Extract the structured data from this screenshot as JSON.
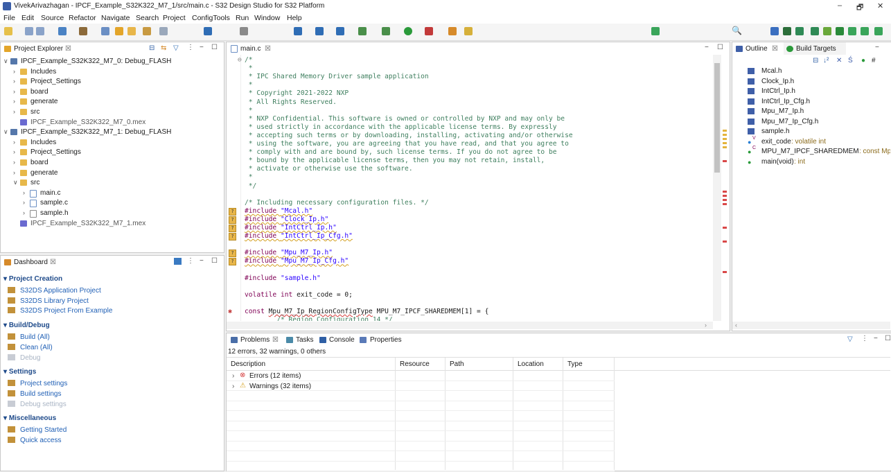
{
  "window": {
    "title": "VivekArivazhagan - IPCF_Example_S32K322_M7_1/src/main.c - S32 Design Studio for S32 Platform",
    "minimize": "–",
    "restore": "🗗",
    "close": "✕"
  },
  "menu": [
    "File",
    "Edit",
    "Source",
    "Refactor",
    "Navigate",
    "Search",
    "Project",
    "ConfigTools",
    "Run",
    "Window",
    "Help"
  ],
  "project_explorer": {
    "tab": "Project Explorer",
    "items": [
      {
        "label": "IPCF_Example_S32K322_M7_0: Debug_FLASH",
        "level": 0,
        "type": "proj",
        "expanded": true
      },
      {
        "label": "Includes",
        "level": 1,
        "type": "inc"
      },
      {
        "label": "Project_Settings",
        "level": 1,
        "type": "fold"
      },
      {
        "label": "board",
        "level": 1,
        "type": "fold"
      },
      {
        "label": "generate",
        "level": 1,
        "type": "fold"
      },
      {
        "label": "src",
        "level": 1,
        "type": "fold"
      },
      {
        "label": "IPCF_Example_S32K322_M7_0.mex",
        "level": 1,
        "type": "mex"
      },
      {
        "label": "IPCF_Example_S32K322_M7_1: Debug_FLASH",
        "level": 0,
        "type": "proj",
        "expanded": true
      },
      {
        "label": "Includes",
        "level": 1,
        "type": "inc"
      },
      {
        "label": "Project_Settings",
        "level": 1,
        "type": "fold"
      },
      {
        "label": "board",
        "level": 1,
        "type": "fold"
      },
      {
        "label": "generate",
        "level": 1,
        "type": "fold"
      },
      {
        "label": "src",
        "level": 1,
        "type": "fold",
        "expanded": true
      },
      {
        "label": "main.c",
        "level": 2,
        "type": "c"
      },
      {
        "label": "sample.c",
        "level": 2,
        "type": "c"
      },
      {
        "label": "sample.h",
        "level": 2,
        "type": "h"
      },
      {
        "label": "IPCF_Example_S32K322_M7_1.mex",
        "level": 1,
        "type": "mex"
      }
    ]
  },
  "dashboard": {
    "tab": "Dashboard",
    "sections": [
      {
        "title": "Project Creation",
        "items": [
          {
            "label": "S32DS Application Project",
            "enabled": true
          },
          {
            "label": "S32DS Library Project",
            "enabled": true
          },
          {
            "label": "S32DS Project From Example",
            "enabled": true
          }
        ]
      },
      {
        "title": "Build/Debug",
        "items": [
          {
            "label": "Build  (All)",
            "enabled": true
          },
          {
            "label": "Clean  (All)",
            "enabled": true
          },
          {
            "label": "Debug",
            "enabled": false
          }
        ]
      },
      {
        "title": "Settings",
        "items": [
          {
            "label": "Project settings",
            "enabled": true
          },
          {
            "label": "Build settings",
            "enabled": true
          },
          {
            "label": "Debug settings",
            "enabled": false
          }
        ]
      },
      {
        "title": "Miscellaneous",
        "items": [
          {
            "label": "Getting Started",
            "enabled": true
          },
          {
            "label": "Quick access",
            "enabled": true
          }
        ]
      }
    ]
  },
  "editor": {
    "tab": "main.c",
    "lines": [
      {
        "t": "/*",
        "c": "cm",
        "fold": "⊖"
      },
      {
        "t": " *",
        "c": "cm"
      },
      {
        "t": " * IPC Shared Memory Driver sample application",
        "c": "cm"
      },
      {
        "t": " *",
        "c": "cm"
      },
      {
        "t": " * Copyright 2021-2022 NXP",
        "c": "cm"
      },
      {
        "t": " * All Rights Reserved.",
        "c": "cm"
      },
      {
        "t": " *",
        "c": "cm"
      },
      {
        "t": " * NXP Confidential. This software is owned or controlled by NXP and may only be",
        "c": "cm"
      },
      {
        "t": " * used strictly in accordance with the applicable license terms. By expressly",
        "c": "cm"
      },
      {
        "t": " * accepting such terms or by downloading, installing, activating and/or otherwise",
        "c": "cm"
      },
      {
        "t": " * using the software, you are agreeing that you have read, and that you agree to",
        "c": "cm"
      },
      {
        "t": " * comply with and are bound by, such license terms. If you do not agree to be",
        "c": "cm"
      },
      {
        "t": " * bound by the applicable license terms, then you may not retain, install,",
        "c": "cm"
      },
      {
        "t": " * activate or otherwise use the software.",
        "c": "cm"
      },
      {
        "t": " *",
        "c": "cm"
      },
      {
        "t": " */",
        "c": "cm"
      },
      {
        "t": "",
        "c": ""
      },
      {
        "t": "/* Including necessary configuration files. */",
        "c": "cm"
      },
      {
        "t": "#include \"Mcal.h\"",
        "c": "inc",
        "warn": true
      },
      {
        "t": "#include \"Clock_Ip.h\"",
        "c": "inc",
        "warn": true
      },
      {
        "t": "#include \"IntCtrl_Ip.h\"",
        "c": "inc",
        "warn": true
      },
      {
        "t": "#include \"IntCtrl_Ip_Cfg.h\"",
        "c": "inc",
        "warn": true
      },
      {
        "t": "",
        "c": ""
      },
      {
        "t": "#include \"Mpu_M7_Ip.h\"",
        "c": "inc",
        "warn": true
      },
      {
        "t": "#include \"Mpu_M7_Ip_Cfg.h\"",
        "c": "inc",
        "warn": true
      },
      {
        "t": "",
        "c": ""
      },
      {
        "t": "#include \"sample.h\"",
        "c": "inc2"
      },
      {
        "t": "",
        "c": ""
      },
      {
        "t": "volatile int exit_code = 0;",
        "c": "decl"
      },
      {
        "t": "",
        "c": ""
      },
      {
        "t": "const Mpu_M7_Ip_RegionConfigType MPU_M7_IPCF_SHAREDMEM[1] = {",
        "c": "const",
        "err": true
      },
      {
        "t": "        /* Region Configuration 14 */",
        "c": "cm"
      }
    ]
  },
  "outline": {
    "tab": "Outline",
    "tab2": "Build Targets",
    "items": [
      "Mcal.h",
      "Clock_Ip.h",
      "IntCtrl_Ip.h",
      "IntCtrl_Ip_Cfg.h",
      "Mpu_M7_Ip.h",
      "Mpu_M7_Ip_Cfg.h",
      "sample.h"
    ],
    "vars": [
      {
        "name": "exit_code",
        "type": " : volatile int",
        "sup": "V"
      },
      {
        "name": "MPU_M7_IPCF_SHAREDMEM",
        "type": " : const Mpu_M",
        "sup": "C"
      },
      {
        "name": "main(void)",
        "type": " : int",
        "sup": ""
      }
    ]
  },
  "problems": {
    "tabs": [
      "Problems",
      "Tasks",
      "Console",
      "Properties"
    ],
    "summary": "12 errors, 32 warnings, 0 others",
    "columns": [
      "Description",
      "Resource",
      "Path",
      "Location",
      "Type"
    ],
    "rows": [
      "Errors (12 items)",
      "Warnings (32 items)"
    ]
  }
}
